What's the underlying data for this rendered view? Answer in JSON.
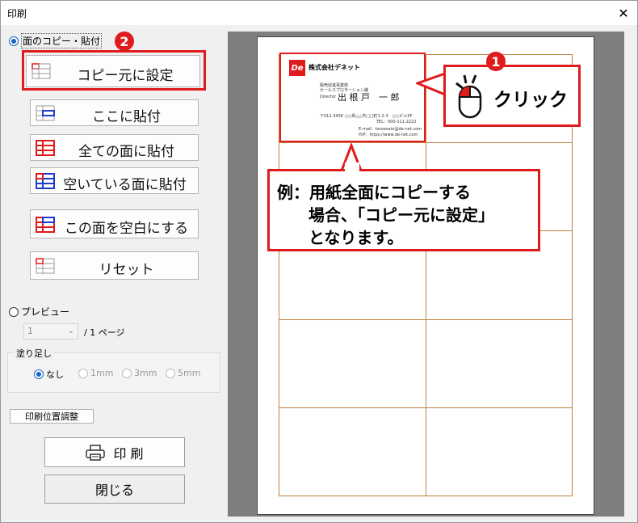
{
  "window": {
    "title": "印刷",
    "close_icon": "✕"
  },
  "mode": {
    "copy_paste_label": "面のコピー・貼付",
    "preview_label": "プレビュー"
  },
  "buttons": {
    "copy_source": "コピー元に設定",
    "paste_here": "ここに貼付",
    "paste_all": "全ての面に貼付",
    "paste_empty": "空いている面に貼付",
    "make_blank": "この面を空白にする",
    "reset": "リセット"
  },
  "page": {
    "current": "1",
    "total_label": "/ 1 ページ"
  },
  "bleed": {
    "title": "塗り足し",
    "options": [
      "なし",
      "1mm",
      "3mm",
      "5mm"
    ],
    "selected": "なし"
  },
  "print_position_label": "印刷位置調整",
  "print_label": "印 刷",
  "close_label": "閉じる",
  "badges": {
    "step1": "1",
    "step2": "2"
  },
  "callouts": {
    "click": "クリック",
    "example_line1": "例：用紙全面にコピーする",
    "example_line2": "場合、「コピー元に設定」",
    "example_line3": "となります。"
  },
  "card": {
    "logo": "De",
    "company": "株式会社デネット",
    "dept1": "販売促進事業部",
    "dept2": "セールスプロモーション課",
    "title": "Director",
    "name": "出 根 戸　一 郎",
    "address": "〒012-3456 ○○県△△市□□町1-2-3　○○ビル5F",
    "tel": "TEL：000-111-2222",
    "email": "E-mail：taroesato@de-net.com",
    "hp": "H/P：https://www.de-net.com"
  },
  "colors": {
    "accent": "#e01b1b",
    "radio": "#1565c0",
    "grid": "#c08040"
  }
}
